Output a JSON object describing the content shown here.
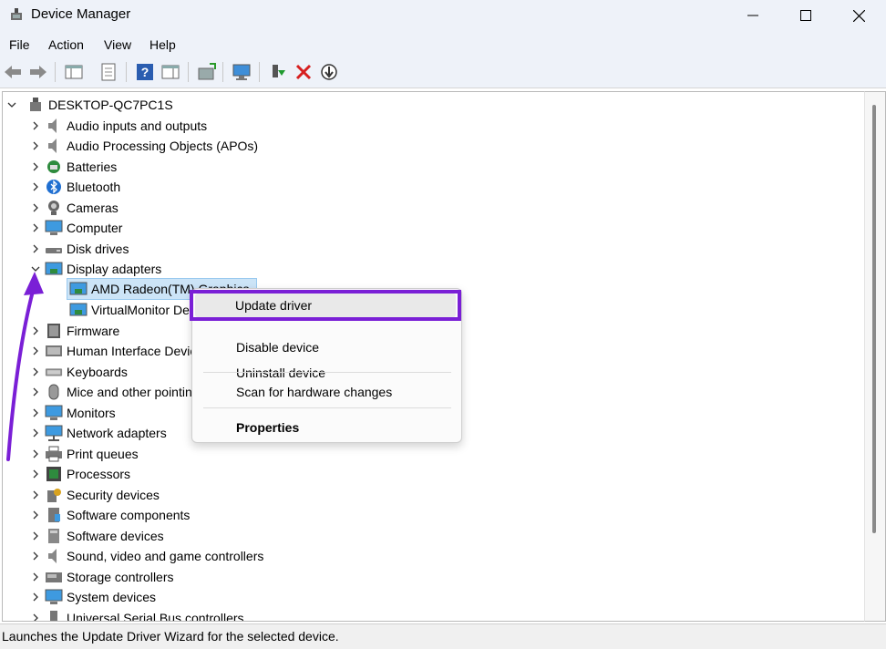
{
  "window": {
    "title": "Device Manager",
    "minimize_glyph": "—",
    "maximize_glyph": "☐",
    "close_glyph": "✕"
  },
  "menu": [
    "File",
    "Action",
    "View",
    "Help"
  ],
  "toolbar": {
    "icons": [
      "back-icon",
      "forward-icon",
      "show-hide-console-tree-icon",
      "properties-icon",
      "help-icon",
      "action-pane-icon",
      "update-driver-icon",
      "scan-hardware-icon",
      "enable-device-icon",
      "uninstall-icon",
      "disable-device-icon"
    ]
  },
  "tree": {
    "root": "DESKTOP-QC7PC1S",
    "categories": [
      {
        "label": "Audio inputs and outputs",
        "icon": "speaker-icon"
      },
      {
        "label": "Audio Processing Objects (APOs)",
        "icon": "speaker-icon"
      },
      {
        "label": "Batteries",
        "icon": "battery-icon"
      },
      {
        "label": "Bluetooth",
        "icon": "bluetooth-icon"
      },
      {
        "label": "Cameras",
        "icon": "camera-icon"
      },
      {
        "label": "Computer",
        "icon": "computer-icon"
      },
      {
        "label": "Disk drives",
        "icon": "disk-drive-icon"
      },
      {
        "label": "Display adapters",
        "icon": "display-adapter-icon",
        "expanded": true
      },
      {
        "label": "Firmware",
        "icon": "firmware-icon"
      },
      {
        "label": "Human Interface Devices",
        "icon": "hid-icon"
      },
      {
        "label": "Keyboards",
        "icon": "keyboard-icon"
      },
      {
        "label": "Mice and other pointing devices",
        "icon": "mouse-icon"
      },
      {
        "label": "Monitors",
        "icon": "monitor-icon"
      },
      {
        "label": "Network adapters",
        "icon": "network-icon"
      },
      {
        "label": "Print queues",
        "icon": "printer-icon"
      },
      {
        "label": "Processors",
        "icon": "processor-icon"
      },
      {
        "label": "Security devices",
        "icon": "security-icon"
      },
      {
        "label": "Software components",
        "icon": "software-component-icon"
      },
      {
        "label": "Software devices",
        "icon": "software-device-icon"
      },
      {
        "label": "Sound, video and game controllers",
        "icon": "speaker-icon"
      },
      {
        "label": "Storage controllers",
        "icon": "storage-icon"
      },
      {
        "label": "System devices",
        "icon": "system-icon"
      },
      {
        "label": "Universal Serial Bus controllers",
        "icon": "usb-icon"
      }
    ],
    "display_children": [
      {
        "label": "AMD Radeon(TM) Graphics",
        "selected": true
      },
      {
        "label": "VirtualMonitor Device"
      }
    ]
  },
  "context_menu": {
    "items": [
      "Update driver",
      "Disable device",
      "Uninstall device",
      "Scan for hardware changes",
      "Properties"
    ]
  },
  "status_bar": "Launches the Update Driver Wizard for the selected device.",
  "colors": {
    "annotation_purple": "#7a1fd6",
    "selection_blue": "#cce4f7"
  }
}
